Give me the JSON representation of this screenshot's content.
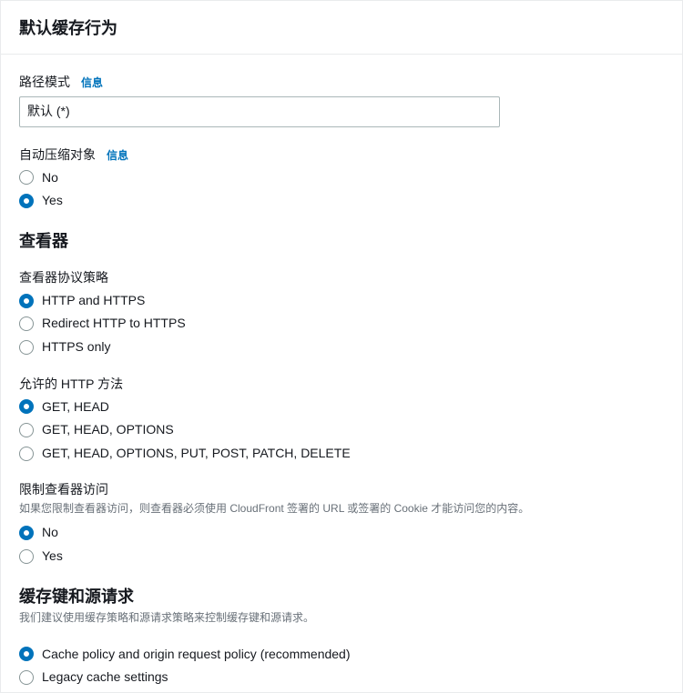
{
  "panelTitle": "默认缓存行为",
  "infoLabel": "信息",
  "pathPattern": {
    "label": "路径模式",
    "value": "默认 (*)"
  },
  "compress": {
    "label": "自动压缩对象",
    "options": [
      "No",
      "Yes"
    ],
    "selected": "Yes"
  },
  "viewerHeading": "查看器",
  "viewerProtocol": {
    "label": "查看器协议策略",
    "options": [
      "HTTP and HTTPS",
      "Redirect HTTP to HTTPS",
      "HTTPS only"
    ],
    "selected": "HTTP and HTTPS"
  },
  "httpMethods": {
    "label": "允许的 HTTP 方法",
    "options": [
      "GET, HEAD",
      "GET, HEAD, OPTIONS",
      "GET, HEAD, OPTIONS, PUT, POST, PATCH, DELETE"
    ],
    "selected": "GET, HEAD"
  },
  "restrictViewer": {
    "label": "限制查看器访问",
    "help": "如果您限制查看器访问，则查看器必须使用 CloudFront 签署的 URL 或签署的 Cookie 才能访问您的内容。",
    "options": [
      "No",
      "Yes"
    ],
    "selected": "No"
  },
  "cacheSection": {
    "heading": "缓存键和源请求",
    "help": "我们建议使用缓存策略和源请求策略来控制缓存键和源请求。",
    "options": [
      "Cache policy and origin request policy (recommended)",
      "Legacy cache settings"
    ],
    "selected": "Cache policy and origin request policy (recommended)"
  }
}
